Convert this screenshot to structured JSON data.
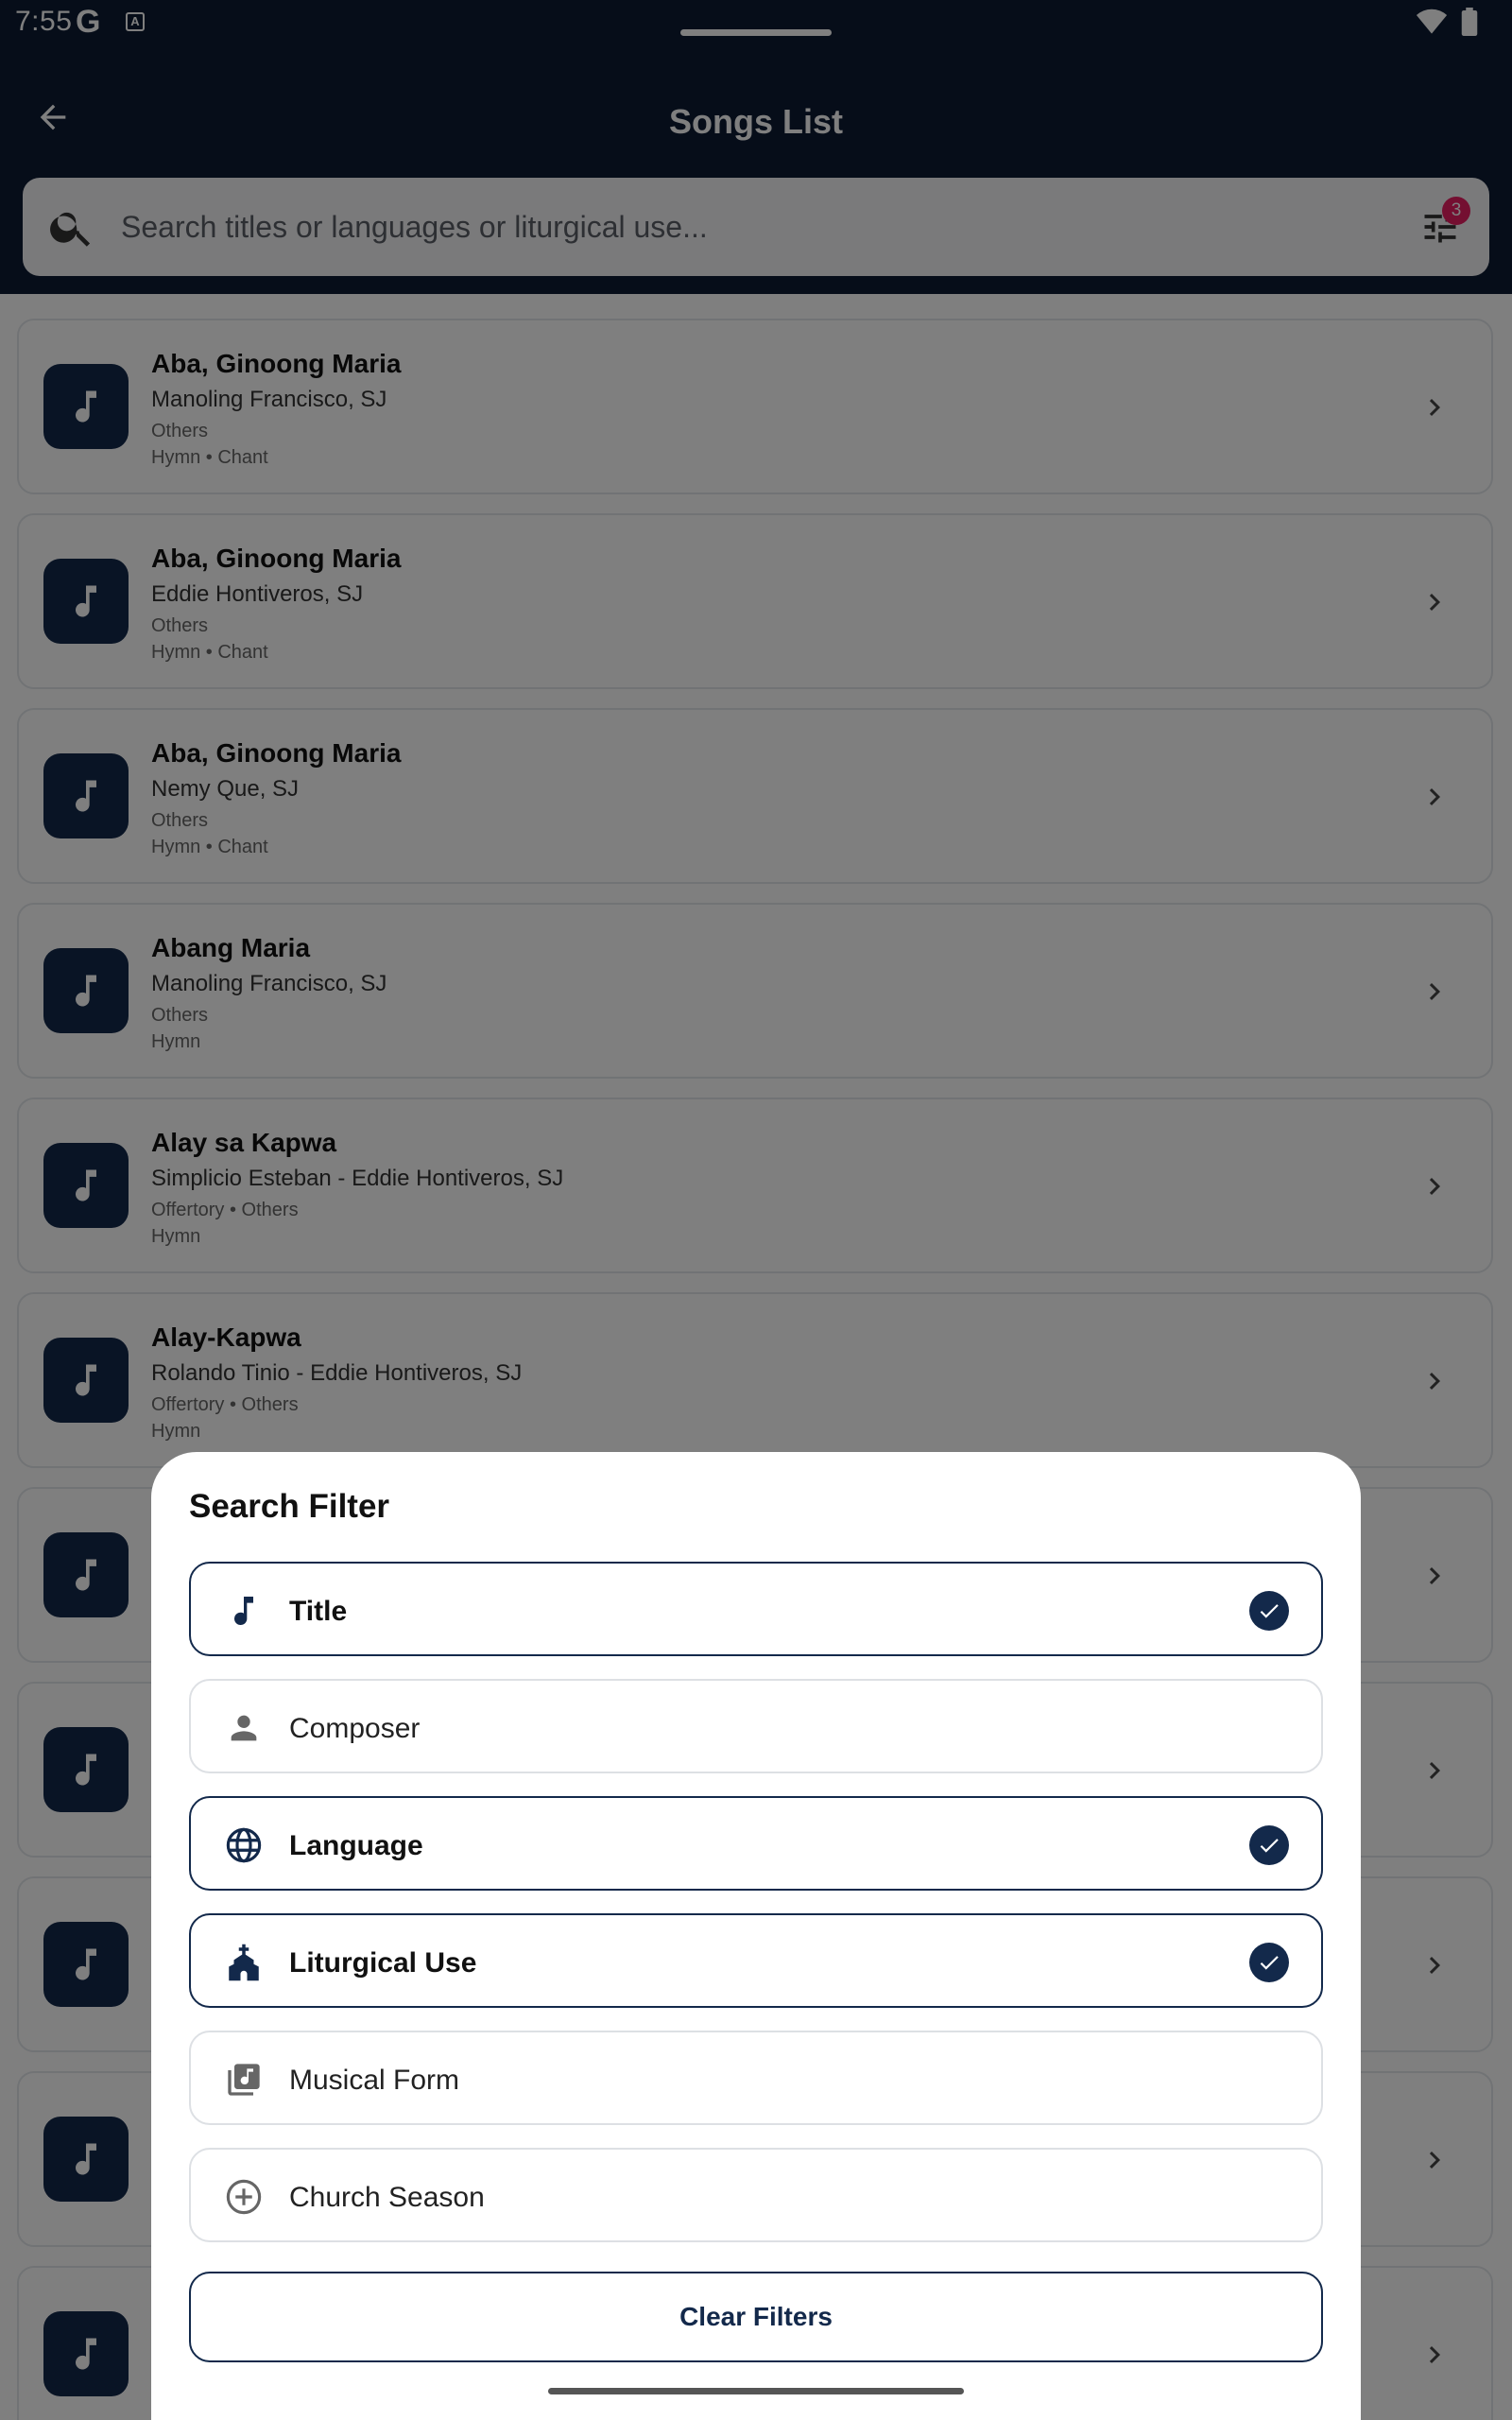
{
  "status_bar": {
    "time": "7:55",
    "g_letter": "G",
    "a_letter": "A"
  },
  "app_bar": {
    "title": "Songs List"
  },
  "search": {
    "placeholder": "Search titles or languages or liturgical use...",
    "filter_badge": "3"
  },
  "songs": [
    {
      "title": "Aba, Ginoong Maria",
      "composer": "Manoling Francisco, SJ",
      "meta": "Others",
      "tags": "Hymn • Chant"
    },
    {
      "title": "Aba, Ginoong Maria",
      "composer": "Eddie Hontiveros, SJ",
      "meta": "Others",
      "tags": "Hymn • Chant"
    },
    {
      "title": "Aba, Ginoong Maria",
      "composer": "Nemy Que, SJ",
      "meta": "Others",
      "tags": "Hymn • Chant"
    },
    {
      "title": "Abang Maria",
      "composer": "Manoling Francisco, SJ",
      "meta": "Others",
      "tags": "Hymn"
    },
    {
      "title": "Alay sa Kapwa",
      "composer": "Simplicio Esteban - Eddie Hontiveros, SJ",
      "meta": "Offertory • Others",
      "tags": "Hymn"
    },
    {
      "title": "Alay-Kapwa",
      "composer": "Rolando Tinio - Eddie Hontiveros, SJ",
      "meta": "Offertory • Others",
      "tags": "Hymn"
    }
  ],
  "sheet": {
    "title": "Search Filter",
    "options": [
      {
        "label": "Title",
        "selected": true,
        "icon": "music-note-icon"
      },
      {
        "label": "Composer",
        "selected": false,
        "icon": "person-icon"
      },
      {
        "label": "Language",
        "selected": true,
        "icon": "globe-icon"
      },
      {
        "label": "Liturgical Use",
        "selected": true,
        "icon": "church-icon"
      },
      {
        "label": "Musical Form",
        "selected": false,
        "icon": "music-library-icon"
      },
      {
        "label": "Church Season",
        "selected": false,
        "icon": "add-circle-icon"
      }
    ],
    "clear_label": "Clear Filters"
  },
  "colors": {
    "primary": "#13294b",
    "topbar": "#0d1a33",
    "badge": "#e91e63"
  }
}
